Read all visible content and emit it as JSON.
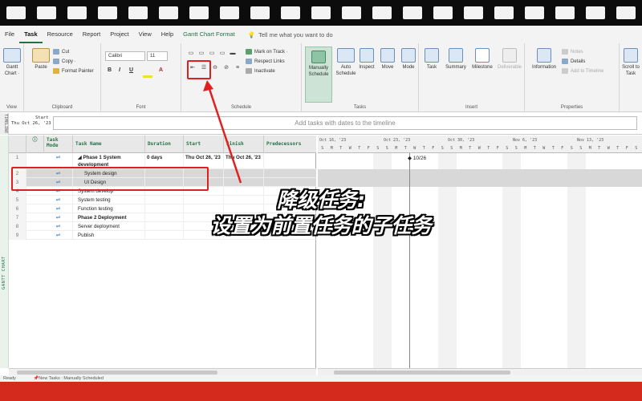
{
  "tabs": [
    "File",
    "Task",
    "Resource",
    "Report",
    "Project",
    "View",
    "Help",
    "Gantt Chart Format"
  ],
  "tell_me": "Tell me what you want to do",
  "ribbon": {
    "view": {
      "gantt": "Gantt",
      "chart": "Chart ·",
      "label": "View"
    },
    "clipboard": {
      "paste": "Paste",
      "cut": "Cut",
      "copy": "Copy ·",
      "format_painter": "Format Painter",
      "label": "Clipboard"
    },
    "font": {
      "family": "Calibri",
      "size": "11",
      "bold": "B",
      "italic": "I",
      "underline": "U",
      "label": "Font"
    },
    "schedule": {
      "mark_on_track": "Mark on Track ·",
      "respect_links": "Respect Links",
      "inactivate": "Inactivate",
      "label": "Schedule"
    },
    "tasks": {
      "manually": "Manually Schedule",
      "auto": "Auto Schedule",
      "inspect": "Inspect",
      "move": "Move",
      "mode": "Mode",
      "label": "Tasks"
    },
    "insert": {
      "task": "Task",
      "summary": "Summary",
      "milestone": "Milestone",
      "deliverable": "Deliverable",
      "label": "Insert"
    },
    "properties": {
      "information": "Information",
      "notes": "Notes",
      "details": "Details",
      "add_to_timeline": "Add to Timeline",
      "label": "Properties"
    },
    "scroll": {
      "label": "Scroll to Task"
    }
  },
  "timeline": {
    "side": "TIMELINE",
    "start_label": "Start",
    "start_date": "Thu Oct 26, '23",
    "placeholder": "Add tasks with dates to the timeline"
  },
  "gantt_side": "GANTT CHART",
  "columns": {
    "mode": "Task Mode",
    "name": "Task Name",
    "duration": "Duration",
    "start": "Start",
    "finish": "Finish",
    "pred": "Predecessors"
  },
  "rows": [
    {
      "num": "1",
      "name": "Phase 1 System development",
      "duration": "0 days",
      "start": "Thu Oct 26, '23",
      "finish": "Thu Oct 26, '23"
    },
    {
      "num": "2",
      "name": "System design",
      "duration": "",
      "start": "",
      "finish": ""
    },
    {
      "num": "3",
      "name": "UI Design",
      "duration": "",
      "start": "",
      "finish": ""
    },
    {
      "num": "4",
      "name": "System develop",
      "duration": "",
      "start": "",
      "finish": ""
    },
    {
      "num": "5",
      "name": "System testing",
      "duration": "",
      "start": "",
      "finish": ""
    },
    {
      "num": "6",
      "name": "Function testing",
      "duration": "",
      "start": "",
      "finish": ""
    },
    {
      "num": "7",
      "name": "Phase 2 Deployment",
      "duration": "",
      "start": "",
      "finish": ""
    },
    {
      "num": "8",
      "name": "Server deployment",
      "duration": "",
      "start": "",
      "finish": ""
    },
    {
      "num": "9",
      "name": "Publish",
      "duration": "",
      "start": "",
      "finish": ""
    }
  ],
  "chart": {
    "weeks": [
      "Oct 16, '23",
      "Oct 23, '23",
      "Oct 30, '23",
      "Nov 6, '23",
      "Nov 13, '23"
    ],
    "days": [
      "S",
      "M",
      "T",
      "W",
      "T",
      "F",
      "S",
      "S",
      "M",
      "T",
      "W",
      "T",
      "F",
      "S",
      "S",
      "M",
      "T",
      "W",
      "T",
      "F",
      "S",
      "S",
      "M",
      "T",
      "W",
      "T",
      "F",
      "S",
      "S",
      "M",
      "T",
      "W",
      "T",
      "F",
      "S"
    ],
    "milestone_label": "10/26"
  },
  "status": {
    "ready": "Ready",
    "new_tasks": "New Tasks : Manually Scheduled"
  },
  "caption": {
    "line1": "降级任务:",
    "line2": "设置为前置任务的子任务"
  }
}
